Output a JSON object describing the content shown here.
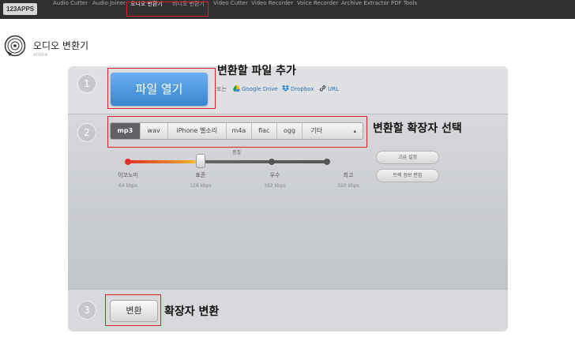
{
  "topbar": {
    "logo": "123APPS",
    "nav": [
      "Audio Cutter",
      "Audio Joiner",
      "오디오 변환기",
      "비디오 변환기",
      "Video Cutter",
      "Video Recorder",
      "Voice Recorder",
      "Archive Extractor",
      "PDF Tools"
    ],
    "active_nav": "오디오 변환기"
  },
  "app": {
    "title": "오디오 변환기",
    "subtitle": "online"
  },
  "step1": {
    "number": "1",
    "open_button": "파일 열기",
    "or_label": "또는",
    "links": {
      "google_drive": "Google Drive",
      "dropbox": "Dropbox",
      "url": "URL"
    },
    "callout": "변환할 파일 추가"
  },
  "step2": {
    "number": "2",
    "formats": [
      "mp3",
      "wav",
      "iPhone 벨소리",
      "m4a",
      "flac",
      "ogg",
      "기타"
    ],
    "selected_format": "mp3",
    "callout": "변환할 확장자 선택",
    "quality": {
      "label": "품질",
      "levels": [
        {
          "name": "이코노미",
          "rate": "64 kbps"
        },
        {
          "name": "표준",
          "rate": "128 kbps"
        },
        {
          "name": "우수",
          "rate": "192 kbps"
        },
        {
          "name": "최고",
          "rate": "320 kbps"
        }
      ],
      "selected": "표준"
    },
    "advanced_button": "고급 설정",
    "track_info_button": "트랙 정보 편집"
  },
  "step3": {
    "number": "3",
    "convert_button": "변환",
    "callout": "확장자 변환"
  },
  "colors": {
    "highlight": "#e0202a",
    "primary": "#3a86d1",
    "topbar": "#2f2f2f"
  }
}
